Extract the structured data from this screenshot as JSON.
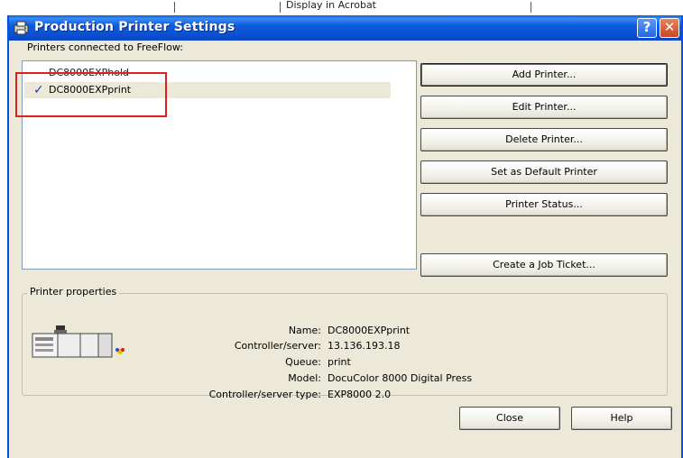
{
  "background": {
    "menu_text": "Display in Acrobat"
  },
  "window": {
    "title": "Production Printer Settings",
    "help_button": "?",
    "close_button": "✕"
  },
  "printers_label": "Printers connected to FreeFlow:",
  "printers": [
    {
      "name": "DC8000EXPhold",
      "checked": false
    },
    {
      "name": "DC8000EXPprint",
      "checked": true
    }
  ],
  "actions": {
    "add": "Add Printer...",
    "edit": "Edit Printer...",
    "delete": "Delete Printer...",
    "set_default": "Set as Default Printer",
    "status": "Printer Status...",
    "job_ticket": "Create a Job Ticket..."
  },
  "properties": {
    "legend": "Printer properties",
    "rows": [
      {
        "key": "Name:",
        "value": "DC8000EXPprint"
      },
      {
        "key": "Controller/server:",
        "value": "13.136.193.18"
      },
      {
        "key": "Queue:",
        "value": "print"
      },
      {
        "key": "Model:",
        "value": "DocuColor 8000 Digital Press"
      },
      {
        "key": "Controller/server type:",
        "value": "EXP8000 2.0"
      }
    ]
  },
  "footer": {
    "close": "Close",
    "help": "Help"
  },
  "colors": {
    "titlebar": "#0a5fd8",
    "dialog_bg": "#ece9d8",
    "highlight_box": "#e02020",
    "check": "#1c3fa8"
  }
}
